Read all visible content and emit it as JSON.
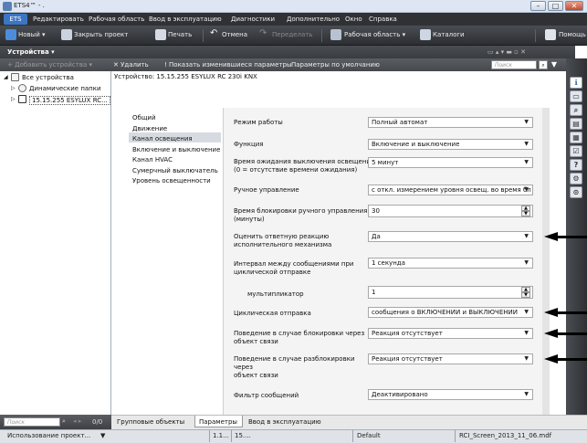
{
  "window": {
    "title": "ETS4™ - ."
  },
  "menu": {
    "ets": "ETS",
    "items": [
      "Редактировать",
      "Рабочая область",
      "Ввод в эксплуатацию",
      "Диагностики",
      "Дополнительно",
      "Окно",
      "Справка"
    ]
  },
  "toolbar": {
    "new": "Новый",
    "close_project": "Закрыть проект",
    "print": "Печать",
    "undo": "Отмена",
    "redo": "Переделать",
    "workspace": "Рабочая область",
    "catalogs": "Каталоги",
    "help": "Помощь"
  },
  "panel": {
    "title": "Устройства",
    "cmd_add": "Добавить устройства",
    "cmd_delete": "Удалить",
    "cmd_show_changed": "Показать изменившиеся параметры",
    "cmd_defaults": "Параметры по умолчанию",
    "search_placeholder": "Поиск"
  },
  "tree": {
    "items": [
      "Все устройства",
      "Динамические папки",
      "15.15.255  ESYLUX RC..."
    ],
    "search_placeholder": "Поиск",
    "count": "0/0"
  },
  "device_label": "Устройство: 15.15.255  ESYLUX RC 230i KNX",
  "nav": [
    "Общий",
    "Движение",
    "Канал освещения",
    "Включение и выключение",
    "Канал HVAC",
    "Сумерчный выключатель",
    "Уровень освещенности"
  ],
  "nav_selected": "Канал освещения",
  "params": [
    {
      "label": "Режим работы",
      "value": "Полный автомат",
      "kind": "dropdown"
    },
    {
      "label": "Функция",
      "value": "Включение и выключение",
      "kind": "dropdown"
    },
    {
      "label": "Время ожидания выключения освещения\n(0 = отсутствие времени ожидания)",
      "value": "5  минут",
      "kind": "dropdown"
    },
    {
      "label": "Ручное управление",
      "value": "с откл. измерением уровня освещ. во время бл",
      "kind": "dropdown"
    },
    {
      "label": "Время блокировки ручного управления\n(минуты)",
      "value": "30",
      "kind": "spin"
    },
    {
      "label": "Оценить ответную реакцию\nисполнительного механизма",
      "value": "Да",
      "kind": "dropdown"
    },
    {
      "label": "Интервал между сообщениями при\nциклической отправке",
      "value": "1 секунда",
      "kind": "dropdown"
    },
    {
      "label": "мультипликатор",
      "value": "1",
      "kind": "spin"
    },
    {
      "label": "Циклическая отправка",
      "value": "сообщения о ВКЛЮЧЕНИИ и ВЫКЛЮЧЕНИИ",
      "kind": "dropdown"
    },
    {
      "label": "Поведение в случае блокировки через\nобъект связи",
      "value": "Реакция отсутствует",
      "kind": "dropdown"
    },
    {
      "label": "Поведение в случае разблокировки\nчерез\nобъект связи",
      "value": "Реакция отсутствует",
      "kind": "dropdown"
    },
    {
      "label": "Фильтр сообщений",
      "value": "Деактивировано",
      "kind": "dropdown"
    }
  ],
  "tabs": [
    "Групповые объекты",
    "Параметры",
    "Ввод в эксплуатацию"
  ],
  "active_tab": "Параметры",
  "status": {
    "task": "Использование проект...",
    "c1": "1.1...",
    "c2": "15....",
    "c3": "Default",
    "c4": "RCI_Screen_2013_11_06.mdf"
  },
  "side_icons": [
    "info-icon",
    "folder-icon",
    "search-icon",
    "catalog-icon",
    "clipboard-icon",
    "report-icon",
    "help-icon",
    "settings-icon",
    "record-icon"
  ],
  "colors": {
    "accent": "#3b76c5",
    "dark_bar": "#2f3135",
    "selection": "#d7dbe1"
  }
}
